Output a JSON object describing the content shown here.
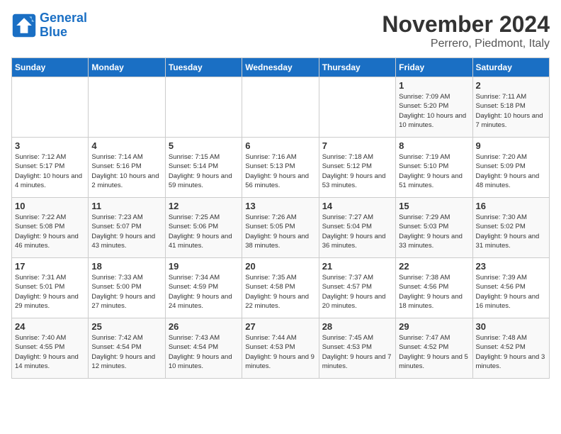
{
  "logo": {
    "line1": "General",
    "line2": "Blue"
  },
  "title": "November 2024",
  "location": "Perrero, Piedmont, Italy",
  "headers": [
    "Sunday",
    "Monday",
    "Tuesday",
    "Wednesday",
    "Thursday",
    "Friday",
    "Saturday"
  ],
  "weeks": [
    [
      {
        "day": "",
        "info": ""
      },
      {
        "day": "",
        "info": ""
      },
      {
        "day": "",
        "info": ""
      },
      {
        "day": "",
        "info": ""
      },
      {
        "day": "",
        "info": ""
      },
      {
        "day": "1",
        "info": "Sunrise: 7:09 AM\nSunset: 5:20 PM\nDaylight: 10 hours and 10 minutes."
      },
      {
        "day": "2",
        "info": "Sunrise: 7:11 AM\nSunset: 5:18 PM\nDaylight: 10 hours and 7 minutes."
      }
    ],
    [
      {
        "day": "3",
        "info": "Sunrise: 7:12 AM\nSunset: 5:17 PM\nDaylight: 10 hours and 4 minutes."
      },
      {
        "day": "4",
        "info": "Sunrise: 7:14 AM\nSunset: 5:16 PM\nDaylight: 10 hours and 2 minutes."
      },
      {
        "day": "5",
        "info": "Sunrise: 7:15 AM\nSunset: 5:14 PM\nDaylight: 9 hours and 59 minutes."
      },
      {
        "day": "6",
        "info": "Sunrise: 7:16 AM\nSunset: 5:13 PM\nDaylight: 9 hours and 56 minutes."
      },
      {
        "day": "7",
        "info": "Sunrise: 7:18 AM\nSunset: 5:12 PM\nDaylight: 9 hours and 53 minutes."
      },
      {
        "day": "8",
        "info": "Sunrise: 7:19 AM\nSunset: 5:10 PM\nDaylight: 9 hours and 51 minutes."
      },
      {
        "day": "9",
        "info": "Sunrise: 7:20 AM\nSunset: 5:09 PM\nDaylight: 9 hours and 48 minutes."
      }
    ],
    [
      {
        "day": "10",
        "info": "Sunrise: 7:22 AM\nSunset: 5:08 PM\nDaylight: 9 hours and 46 minutes."
      },
      {
        "day": "11",
        "info": "Sunrise: 7:23 AM\nSunset: 5:07 PM\nDaylight: 9 hours and 43 minutes."
      },
      {
        "day": "12",
        "info": "Sunrise: 7:25 AM\nSunset: 5:06 PM\nDaylight: 9 hours and 41 minutes."
      },
      {
        "day": "13",
        "info": "Sunrise: 7:26 AM\nSunset: 5:05 PM\nDaylight: 9 hours and 38 minutes."
      },
      {
        "day": "14",
        "info": "Sunrise: 7:27 AM\nSunset: 5:04 PM\nDaylight: 9 hours and 36 minutes."
      },
      {
        "day": "15",
        "info": "Sunrise: 7:29 AM\nSunset: 5:03 PM\nDaylight: 9 hours and 33 minutes."
      },
      {
        "day": "16",
        "info": "Sunrise: 7:30 AM\nSunset: 5:02 PM\nDaylight: 9 hours and 31 minutes."
      }
    ],
    [
      {
        "day": "17",
        "info": "Sunrise: 7:31 AM\nSunset: 5:01 PM\nDaylight: 9 hours and 29 minutes."
      },
      {
        "day": "18",
        "info": "Sunrise: 7:33 AM\nSunset: 5:00 PM\nDaylight: 9 hours and 27 minutes."
      },
      {
        "day": "19",
        "info": "Sunrise: 7:34 AM\nSunset: 4:59 PM\nDaylight: 9 hours and 24 minutes."
      },
      {
        "day": "20",
        "info": "Sunrise: 7:35 AM\nSunset: 4:58 PM\nDaylight: 9 hours and 22 minutes."
      },
      {
        "day": "21",
        "info": "Sunrise: 7:37 AM\nSunset: 4:57 PM\nDaylight: 9 hours and 20 minutes."
      },
      {
        "day": "22",
        "info": "Sunrise: 7:38 AM\nSunset: 4:56 PM\nDaylight: 9 hours and 18 minutes."
      },
      {
        "day": "23",
        "info": "Sunrise: 7:39 AM\nSunset: 4:56 PM\nDaylight: 9 hours and 16 minutes."
      }
    ],
    [
      {
        "day": "24",
        "info": "Sunrise: 7:40 AM\nSunset: 4:55 PM\nDaylight: 9 hours and 14 minutes."
      },
      {
        "day": "25",
        "info": "Sunrise: 7:42 AM\nSunset: 4:54 PM\nDaylight: 9 hours and 12 minutes."
      },
      {
        "day": "26",
        "info": "Sunrise: 7:43 AM\nSunset: 4:54 PM\nDaylight: 9 hours and 10 minutes."
      },
      {
        "day": "27",
        "info": "Sunrise: 7:44 AM\nSunset: 4:53 PM\nDaylight: 9 hours and 9 minutes."
      },
      {
        "day": "28",
        "info": "Sunrise: 7:45 AM\nSunset: 4:53 PM\nDaylight: 9 hours and 7 minutes."
      },
      {
        "day": "29",
        "info": "Sunrise: 7:47 AM\nSunset: 4:52 PM\nDaylight: 9 hours and 5 minutes."
      },
      {
        "day": "30",
        "info": "Sunrise: 7:48 AM\nSunset: 4:52 PM\nDaylight: 9 hours and 3 minutes."
      }
    ]
  ]
}
